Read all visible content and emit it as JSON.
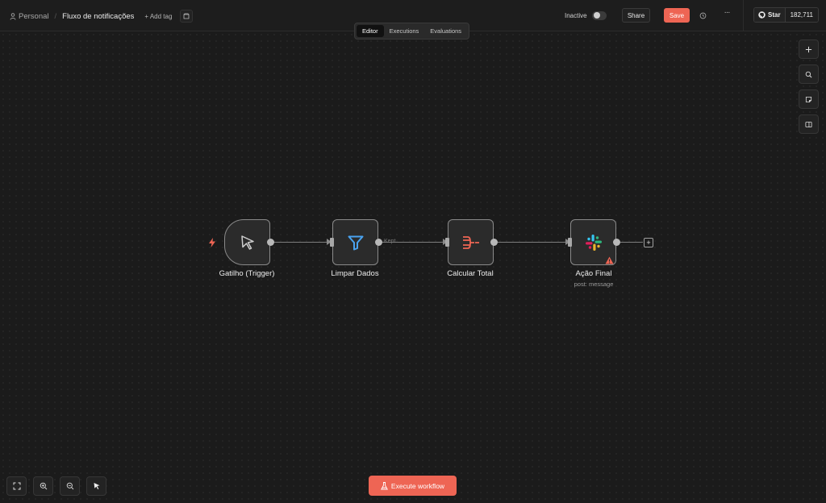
{
  "header": {
    "project": "Personal",
    "workflow_name": "Fluxo de notificações",
    "add_tag": "+ Add tag",
    "status_label": "Inactive",
    "share_label": "Share",
    "save_label": "Save",
    "more_label": "···",
    "github_star_label": "Star",
    "github_star_count": "182,711"
  },
  "tabs": [
    {
      "label": "Editor",
      "active": true
    },
    {
      "label": "Executions",
      "active": false
    },
    {
      "label": "Evaluations",
      "active": false
    }
  ],
  "nodes": [
    {
      "label": "Gatilho (Trigger)",
      "subtitle": "",
      "icon": "cursor-icon"
    },
    {
      "label": "Limpar Dados",
      "subtitle": "",
      "icon": "filter-icon"
    },
    {
      "label": "Calcular Total",
      "subtitle": "",
      "icon": "merge-icon"
    },
    {
      "label": "Ação Final",
      "subtitle": "post: message",
      "icon": "slack-icon"
    }
  ],
  "edges": [
    {
      "label": ""
    },
    {
      "label": "Kept"
    },
    {
      "label": ""
    }
  ],
  "execute_label": "Execute workflow",
  "colors": {
    "accent": "#ee6554",
    "canvas": "#1b1b1b",
    "filter_icon": "#4aa3f0",
    "warning": "#ee6554"
  }
}
